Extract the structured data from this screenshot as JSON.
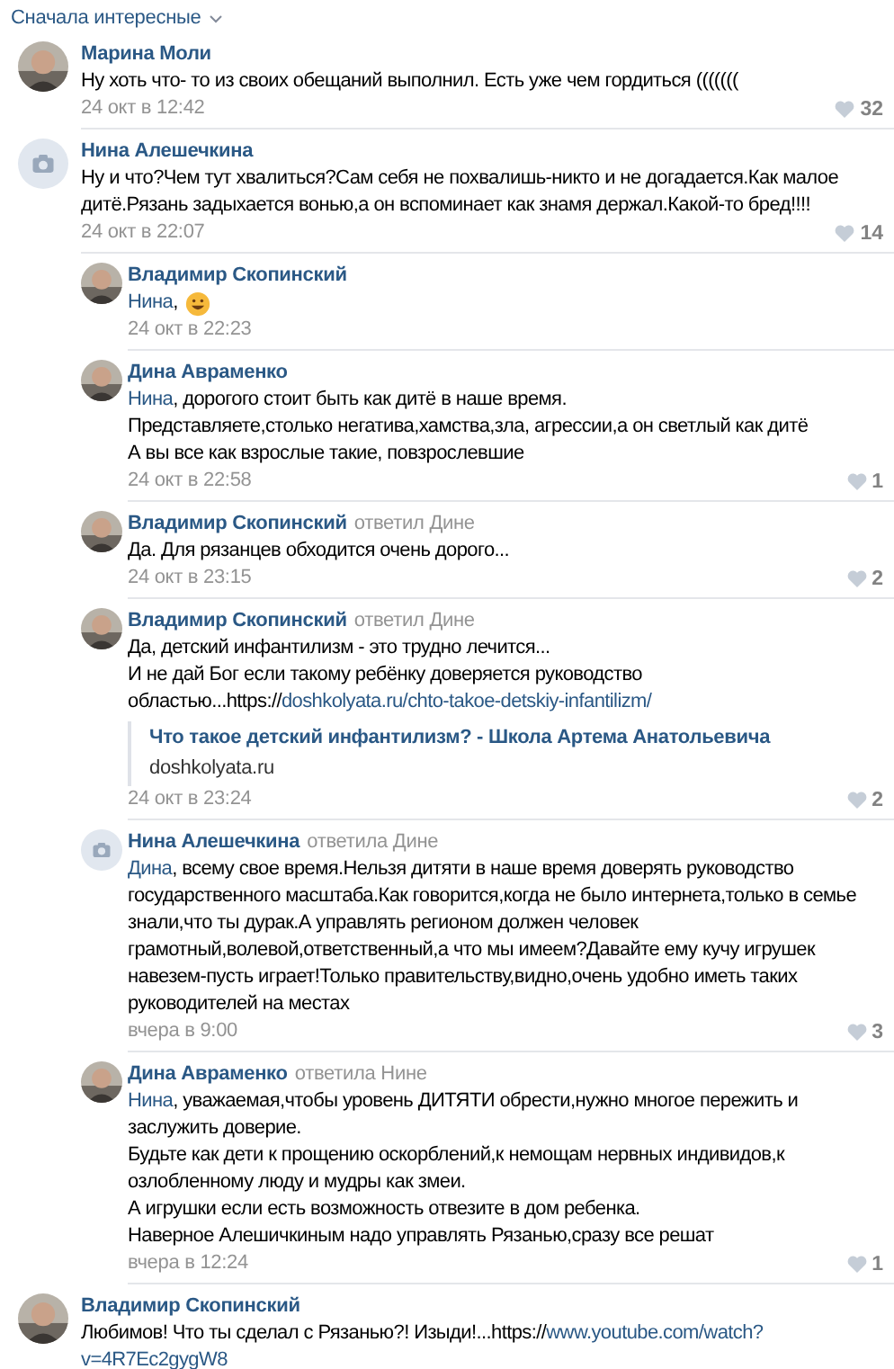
{
  "sort": {
    "label": "Сначала интересные"
  },
  "comments": [
    {
      "has_photo": true,
      "author": "Марина Моли",
      "lines": [
        [
          {
            "kind": "plain",
            "text": "Ну хоть что- то из своих обещаний выполнил. Есть уже чем гордиться ((((((("
          }
        ]
      ],
      "date": "24 окт в 12:42",
      "likes": "32"
    },
    {
      "has_photo": false,
      "author": "Нина Алешечкина",
      "lines": [
        [
          {
            "kind": "plain",
            "text": "Ну и что?Чем тут хвалиться?Сам себя не похвалишь-никто и не догадается.Как малое"
          }
        ],
        [
          {
            "kind": "plain",
            "text": "дитё.Рязань задыхается вонью,а он вспоминает как знамя держал.Какой-то бред!!!!"
          }
        ]
      ],
      "date": "24 окт в 22:07",
      "likes": "14",
      "replies": [
        {
          "has_photo": true,
          "author": "Владимир Скопинский",
          "lines": [
            [
              {
                "kind": "mention",
                "text": "Нина"
              },
              {
                "kind": "plain",
                "text": ","
              },
              {
                "kind": "emoji"
              }
            ]
          ],
          "date": "24 окт в 22:23"
        },
        {
          "has_photo": true,
          "author": "Дина Авраменко",
          "lines": [
            [
              {
                "kind": "mention",
                "text": "Нина"
              },
              {
                "kind": "plain",
                "text": ", дорогого стоит быть как дитё в наше время."
              }
            ],
            [
              {
                "kind": "plain",
                "text": "Представляете,столько негатива,хамства,зла, агрессии,а он светлый как дитё"
              }
            ],
            [
              {
                "kind": "plain",
                "text": "А вы все как взрослые такие, повзрослевшие"
              }
            ]
          ],
          "date": "24 окт в 22:58",
          "likes": "1"
        },
        {
          "has_photo": true,
          "author": "Владимир Скопинский",
          "reply_to": "ответил Дине",
          "lines": [
            [
              {
                "kind": "plain",
                "text": "Да. Для рязанцев обходится очень дорого..."
              }
            ]
          ],
          "date": "24 окт в 23:15",
          "likes": "2"
        },
        {
          "has_photo": true,
          "author": "Владимир Скопинский",
          "reply_to": "ответил Дине",
          "lines": [
            [
              {
                "kind": "plain",
                "text": "Да, детский инфантилизм - это трудно лечится..."
              }
            ],
            [
              {
                "kind": "plain",
                "text": "И не дай Бог если такому ребёнку доверяется руководство"
              }
            ],
            [
              {
                "kind": "plain",
                "text": "областью...https://"
              },
              {
                "kind": "link",
                "text": "doshkolyata.ru/chto-takoe-detskiy-infantilizm/"
              }
            ]
          ],
          "preview": {
            "title": "Что такое детский инфантилизм? - Школа Артема Анатольевича",
            "domain": "doshkolyata.ru"
          },
          "date": "24 окт в 23:24",
          "likes": "2"
        },
        {
          "has_photo": false,
          "author": "Нина Алешечкина",
          "reply_to": "ответила Дине",
          "lines": [
            [
              {
                "kind": "mention",
                "text": "Дина"
              },
              {
                "kind": "plain",
                "text": ", всему свое время.Нельзя дитяти в наше время доверять руководство"
              }
            ],
            [
              {
                "kind": "plain",
                "text": "государственного масштаба.Как говорится,когда не было интернета,только в семье"
              }
            ],
            [
              {
                "kind": "plain",
                "text": "знали,что ты дурак.А управлять регионом должен человек"
              }
            ],
            [
              {
                "kind": "plain",
                "text": "грамотный,волевой,ответственный,а что мы имеем?Давайте ему кучу игрушек"
              }
            ],
            [
              {
                "kind": "plain",
                "text": "навезем-пусть играет!Только правительству,видно,очень удобно иметь таких"
              }
            ],
            [
              {
                "kind": "plain",
                "text": "руководителей на местах"
              }
            ]
          ],
          "date": "вчера в 9:00",
          "likes": "3"
        },
        {
          "has_photo": true,
          "author": "Дина Авраменко",
          "reply_to": "ответила Нине",
          "lines": [
            [
              {
                "kind": "mention",
                "text": "Нина"
              },
              {
                "kind": "plain",
                "text": ", уважаемая,чтобы уровень ДИТЯТИ обрести,нужно многое пережить и"
              }
            ],
            [
              {
                "kind": "plain",
                "text": "заслужить доверие."
              }
            ],
            [
              {
                "kind": "plain",
                "text": "Будьте как дети к прощению оскорблений,к немощам нервных индивидов,к"
              }
            ],
            [
              {
                "kind": "plain",
                "text": "озлобленному люду и мудры как змеи."
              }
            ],
            [
              {
                "kind": "plain",
                "text": "А игрушки если есть возможность отвезите в дом ребенка."
              }
            ],
            [
              {
                "kind": "plain",
                "text": "Наверное Алешичкиным надо управлять Рязанью,сразу все решат"
              }
            ]
          ],
          "date": "вчера в 12:24",
          "likes": "1"
        }
      ]
    },
    {
      "has_photo": true,
      "author": "Владимир Скопинский",
      "lines": [
        [
          {
            "kind": "plain",
            "text": "Любимов! Что ты сделал с Рязанью?! Изыди!...https://"
          },
          {
            "kind": "link",
            "text": "www.youtube.com/watch?"
          }
        ],
        [
          {
            "kind": "link",
            "text": "v=4R7Ec2gygW8"
          }
        ]
      ]
    }
  ]
}
